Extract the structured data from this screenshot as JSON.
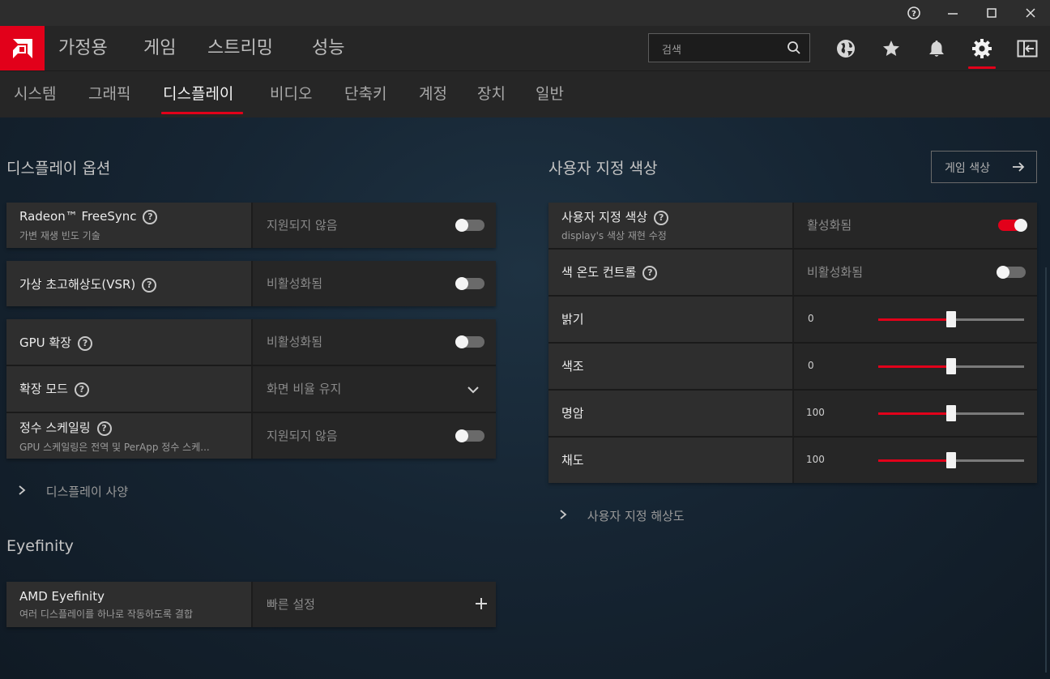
{
  "window": {
    "help": "?",
    "minimize": "—",
    "maximize": "☐",
    "close": "✕"
  },
  "topnav": {
    "items": [
      "가정용",
      "게임",
      "스트리밍",
      "성능"
    ],
    "search_placeholder": "검색"
  },
  "subnav": {
    "items": [
      "시스템",
      "그래픽",
      "디스플레이",
      "비디오",
      "단축키",
      "계정",
      "장치",
      "일반"
    ],
    "active": "디스플레이"
  },
  "display_options": {
    "title": "디스플레이 옵션",
    "freesync": {
      "label": "Radeon™ FreeSync",
      "sub": "가변 재생 빈도 기술",
      "value": "지원되지 않음",
      "toggle": "off"
    },
    "vsr": {
      "label": "가상 초고해상도(VSR)",
      "value": "비활성화됨",
      "toggle": "off"
    },
    "gpu_scaling": {
      "label": "GPU 확장",
      "value": "비활성화됨",
      "toggle": "off"
    },
    "scaling_mode": {
      "label": "확장 모드",
      "value": "화면 비율 유지"
    },
    "integer_scaling": {
      "label": "정수 스케일링",
      "sub": "GPU 스케일링은 전역 및 PerApp 정수 스케...",
      "value": "지원되지 않음",
      "toggle": "off"
    },
    "specs_link": "디스플레이 사양"
  },
  "eyefinity": {
    "title": "Eyefinity",
    "amd": {
      "label": "AMD Eyefinity",
      "sub": "여러 디스플레이를 하나로 작동하도록 결합",
      "value": "빠른 설정"
    }
  },
  "custom_color": {
    "title": "사용자 지정 색상",
    "game_color_button": "게임 색상",
    "custom": {
      "label": "사용자 지정 색상",
      "sub": "display's 색상 재현 수정",
      "value": "활성화됨",
      "toggle": "on"
    },
    "temp": {
      "label": "색 온도 컨트롤",
      "value": "비활성화됨",
      "toggle": "off"
    },
    "brightness": {
      "label": "밝기",
      "value": "0",
      "level": 0.5
    },
    "hue": {
      "label": "색조",
      "value": "0",
      "level": 0.5
    },
    "contrast": {
      "label": "명암",
      "value": "100",
      "level": 0.5
    },
    "saturation": {
      "label": "채도",
      "value": "100",
      "level": 0.5
    },
    "resolution_link": "사용자 지정 해상도"
  },
  "colors": {
    "accent": "#e2001a"
  }
}
